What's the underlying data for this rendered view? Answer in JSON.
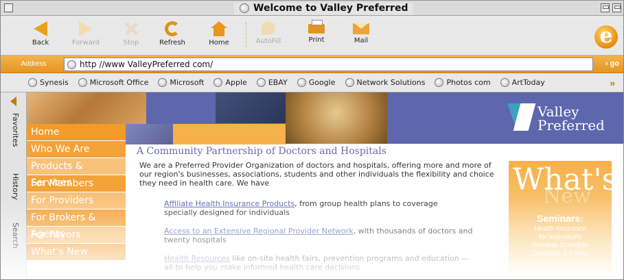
{
  "window": {
    "title": "Welcome to Valley Preferred"
  },
  "toolbar": {
    "back": "Back",
    "forward": "Forward",
    "stop": "Stop",
    "refresh": "Refresh",
    "home": "Home",
    "autofill": "AutoFill",
    "print": "Print",
    "mail": "Mail"
  },
  "address": {
    "label": "Address",
    "url": "http //www ValleyPreferred com/",
    "go": "go"
  },
  "favorites": [
    "Synesis",
    "Microsoft Office",
    "Microsoft",
    "Apple",
    "EBAY",
    "Google",
    "Network Solutions",
    "Photos com",
    "ArtToday"
  ],
  "sidebar_tabs": [
    "Favorites",
    "History",
    "Search"
  ],
  "site": {
    "logo_line1": "Valley",
    "logo_line2": "Preferred",
    "nav": [
      "Home",
      "Who We Are",
      "Products & Services",
      "For Members",
      "For Providers",
      "For Brokers & Agents",
      "For Payors",
      "What's New"
    ],
    "headline": "A Community Partnership of Doctors and Hospitals",
    "intro": "We are a Preferred Provider Organization of doctors and hospitals, offering more and more of our region's businesses, associations, students and other individuals the flexibility and choice they need in health care. We have",
    "bullets": [
      {
        "link": "Affiliate Health Insurance Products",
        "text": ", from group health plans to coverage specially designed for individuals"
      },
      {
        "link": "Access to an Extensive Regional Provider Network",
        "text": ", with thousands of doctors and twenty hospitals"
      },
      {
        "link": "Health Resources",
        "text": " like on-site health fairs, prevention programs and education — all to help you make informed health care decisions"
      }
    ],
    "whats_new": {
      "title": "What's",
      "subtitle": "New",
      "seminars": "Seminars:",
      "items": [
        "Health Insurance",
        "for Individuals",
        "Seminar Schedule",
        "Contracts & Forms"
      ]
    }
  }
}
